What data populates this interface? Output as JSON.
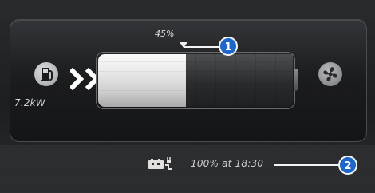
{
  "charging": {
    "power_label": "7.2kW",
    "state_of_charge_label": "45%",
    "state_of_charge_value": 0.45,
    "status_text": "100% at 18:30",
    "callouts": [
      "1",
      "2"
    ],
    "icons": {
      "charger": "ev-charger-icon",
      "fan": "fan-icon",
      "status": "battery-plug-icon",
      "flow": "chevron-right-icon"
    },
    "colors": {
      "callout": "#1e66c7",
      "fill": "#ededed",
      "text": "#d0d0d0"
    }
  }
}
